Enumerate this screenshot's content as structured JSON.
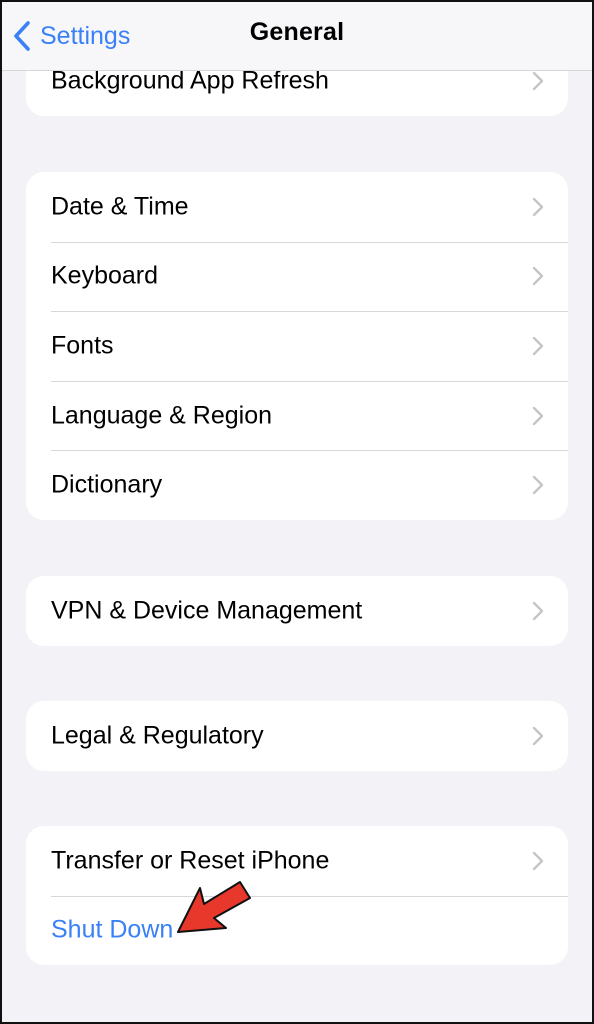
{
  "nav": {
    "back_label": "Settings",
    "title": "General"
  },
  "groups": [
    {
      "items": [
        {
          "label": "Background App Refresh"
        }
      ]
    },
    {
      "items": [
        {
          "label": "Date & Time"
        },
        {
          "label": "Keyboard"
        },
        {
          "label": "Fonts"
        },
        {
          "label": "Language & Region"
        },
        {
          "label": "Dictionary"
        }
      ]
    },
    {
      "items": [
        {
          "label": "VPN & Device Management"
        }
      ]
    },
    {
      "items": [
        {
          "label": "Legal & Regulatory"
        }
      ]
    },
    {
      "items": [
        {
          "label": "Transfer or Reset iPhone"
        },
        {
          "label": "Shut Down"
        }
      ]
    }
  ],
  "colors": {
    "accent": "#3a80f6",
    "background": "#f2f2f7",
    "annotation_arrow": "#e8382b"
  },
  "icons": {
    "back": "chevron-left-icon",
    "disclosure": "chevron-right-icon",
    "annotation": "pointer-arrow-icon"
  }
}
